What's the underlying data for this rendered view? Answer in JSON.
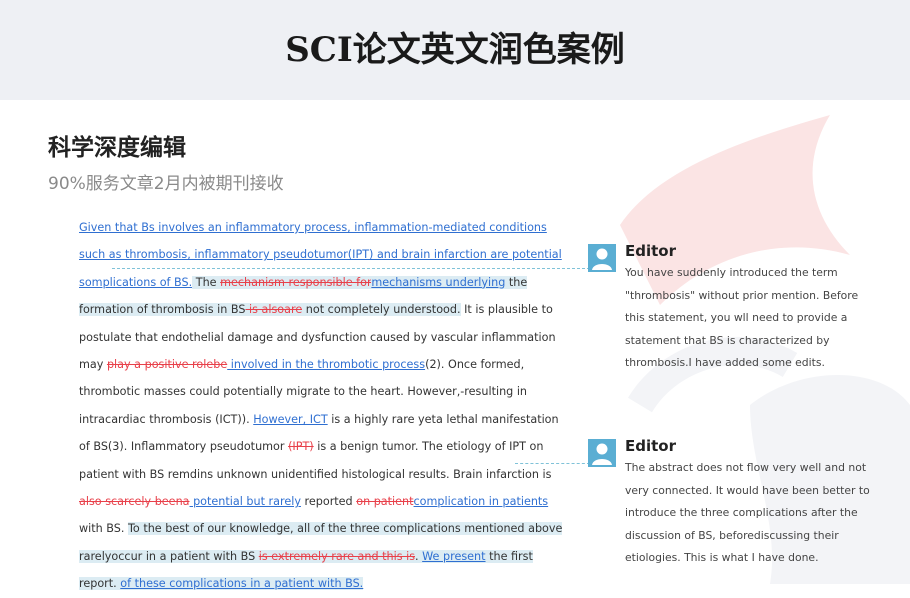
{
  "header": {
    "title": "SCI论文英文润色案例"
  },
  "section": {
    "title": "科学深度编辑",
    "subtitle": "90%服务文章2月内被期刊接收"
  },
  "document": {
    "segments": [
      {
        "text": "Given that Bs involves an inflammatory process, inflammation-mediated conditions such as thrombosis, inflammatory pseudotumor(IPT) and brain infarction are potential somplications of BS.",
        "type": "ins"
      },
      {
        "text": " The ",
        "type": "plain",
        "hl": true
      },
      {
        "text": "mechanism responsible for",
        "type": "del",
        "hl": true
      },
      {
        "text": "mechanisms underlying",
        "type": "ins",
        "hl": true
      },
      {
        "text": " the formation of thrombosis in BS",
        "type": "plain",
        "hl": true
      },
      {
        "text": " is alsoare",
        "type": "del",
        "hl": true
      },
      {
        "text": " not completely understood.",
        "type": "plain",
        "hl": true
      },
      {
        "text": " It is plausible to postulate that endothelial damage and dysfunction caused by vascular inflammation may ",
        "type": "plain"
      },
      {
        "text": "play a positive rolebe",
        "type": "del"
      },
      {
        "text": " involved in the thrombotic process",
        "type": "ins"
      },
      {
        "text": "(2). Once formed, thrombotic masses could potentially migrate to the heart. However,-resulting in intracardiac thrombosis (ICT)). ",
        "type": "plain"
      },
      {
        "text": "However, ICT",
        "type": "ins"
      },
      {
        "text": " is a highly rare yeta lethal manifestation of BS(3). Inflammatory pseudotumor ",
        "type": "plain"
      },
      {
        "text": "(IPT)",
        "type": "del"
      },
      {
        "text": " is a benign tumor. The etiology of IPT on patient with BS remdins unknown unidentified histological results. Brain infarction is ",
        "type": "plain"
      },
      {
        "text": "also scarcely beena",
        "type": "del"
      },
      {
        "text": " potential but rarely",
        "type": "ins"
      },
      {
        "text": " reported ",
        "type": "plain"
      },
      {
        "text": "on patient",
        "type": "del"
      },
      {
        "text": "complication in patients",
        "type": "ins"
      },
      {
        "text": " with BS. ",
        "type": "plain"
      },
      {
        "text": "To the best of our knowledge, all of the three complications mentioned above rarelyoccur in a patient with BS ",
        "type": "plain",
        "hl": true
      },
      {
        "text": "is extremely rare and this is",
        "type": "del",
        "hl": true
      },
      {
        "text": ". ",
        "type": "plain",
        "hl": true
      },
      {
        "text": "We present",
        "type": "ins",
        "hl": true
      },
      {
        "text": " the first report. ",
        "type": "plain",
        "hl": true
      },
      {
        "text": "of these complications in a patient with BS.",
        "type": "ins",
        "hl": true
      }
    ]
  },
  "comments": [
    {
      "author": "Editor",
      "text": "You have suddenly introduced the term \"thrombosis\" without prior mention. Before this statement, you wll need to provide a statement that BS is characterized by thrombosis.I have added some edits."
    },
    {
      "author": "Editor",
      "text": "The abstract does not flow very well and not very connected. It would have been better to introduce the three complications after the discussion of BS, beforediscussing their etiologies. This is what I have done."
    }
  ],
  "colors": {
    "insert": "#2f6fd1",
    "delete": "#e8404a",
    "highlight": "#dcecf3",
    "avatar": "#5aaed3",
    "banner": "#eef0f4"
  }
}
